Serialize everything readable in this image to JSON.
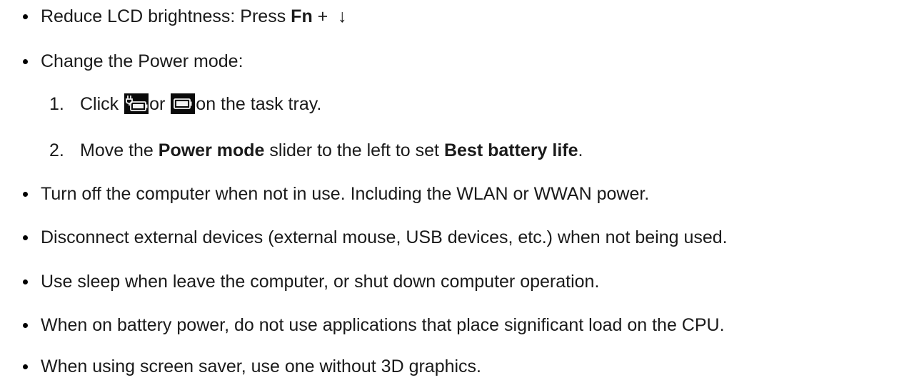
{
  "items": [
    {
      "type": "bullet",
      "before": "Reduce LCD brightness: Press ",
      "bold": "Fn",
      "after": " +  ",
      "arrow": "↓"
    },
    {
      "type": "bullet",
      "text": "Change the Power mode:"
    },
    {
      "type": "numbered",
      "num": "1.",
      "before": "Click ",
      "mid": "or ",
      "after": "on the task tray."
    },
    {
      "type": "numbered",
      "num": "2.",
      "before": "Move the ",
      "bold1": "Power mode",
      "mid": " slider to the left to set ",
      "bold2": "Best battery life",
      "after": "."
    },
    {
      "type": "bullet",
      "text": "Turn off the computer when not in use. Including the WLAN or WWAN power."
    },
    {
      "type": "bullet",
      "text": "Disconnect external devices (external mouse, USB devices, etc.) when not being used."
    },
    {
      "type": "bullet",
      "text": "Use sleep when leave the computer, or shut down computer operation."
    },
    {
      "type": "bullet",
      "text": "When on battery power, do not use applications that place significant load on the CPU."
    },
    {
      "type": "bullet",
      "text": "When using screen saver, use one without 3D graphics."
    }
  ],
  "icons": {
    "icon1": "battery-charging-icon",
    "icon2": "battery-icon"
  }
}
